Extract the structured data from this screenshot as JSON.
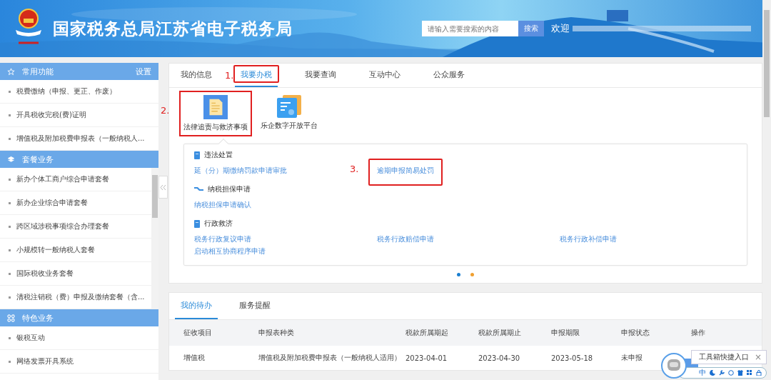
{
  "header": {
    "title": "国家税务总局江苏省电子税务局",
    "search_placeholder": "请输入需要搜索的内容",
    "search_button": "搜索",
    "welcome": "欢迎"
  },
  "sidebar": {
    "sections": [
      {
        "title": "常用功能",
        "action": "设置",
        "scrollable": false,
        "items": [
          "税费缴纳（申报、更正、作废）",
          "开具税收完税(费)证明",
          "增值税及附加税费申报表（一般纳税人..."
        ]
      },
      {
        "title": "套餐业务",
        "scrollable": true,
        "items": [
          "新办个体工商户综合申请套餐",
          "新办企业综合申请套餐",
          "跨区域涉税事项综合办理套餐",
          "小规模转一般纳税人套餐",
          "国际税收业务套餐",
          "清税注销税（费）申报及缴纳套餐（含..."
        ]
      },
      {
        "title": "特色业务",
        "scrollable": false,
        "items": [
          "银税互动",
          "网络发票开具系统"
        ]
      }
    ]
  },
  "tabs": [
    {
      "label": "我的信息",
      "selected": false
    },
    {
      "label": "我要办税",
      "selected": true,
      "annotation": "1."
    },
    {
      "label": "我要查询",
      "selected": false
    },
    {
      "label": "互动中心",
      "selected": false
    },
    {
      "label": "公众服务",
      "selected": false
    }
  ],
  "services": [
    {
      "label": "法律追责与救济事项",
      "selected": true,
      "annotation": "2."
    },
    {
      "label": "乐企数字开放平台",
      "selected": false
    }
  ],
  "groups": [
    {
      "title": "违法处置",
      "links": [
        {
          "label": "延（分）期缴纳罚款申请审批"
        },
        {
          "label": "逾期申报简易处罚",
          "annotation": "3."
        }
      ]
    },
    {
      "title": "纳税担保申请",
      "links": [
        {
          "label": "纳税担保申请确认"
        }
      ]
    },
    {
      "title": "行政救济",
      "links": [
        {
          "label": "税务行政复议申请"
        },
        {
          "label": "税务行政赔偿申请"
        },
        {
          "label": "税务行政补偿申请"
        },
        {
          "label": "启动相互协商程序申请"
        }
      ]
    }
  ],
  "carousel_dots": [
    {
      "selected": true
    },
    {
      "selected": false
    }
  ],
  "todo": {
    "tabs": [
      {
        "label": "我的待办",
        "selected": true
      },
      {
        "label": "服务提醒",
        "selected": false
      }
    ],
    "columns": [
      "征收项目",
      "申报表种类",
      "税款所属期起",
      "税款所属期止",
      "申报期限",
      "申报状态",
      "操作"
    ],
    "rows": [
      [
        "增值税",
        "增值税及附加税费申报表（一般纳税人适用）",
        "2023-04-01",
        "2023-04-30",
        "2023-05-18",
        "未申报"
      ]
    ]
  },
  "toolbox": {
    "tooltip": "工具箱快捷入口",
    "close": "×",
    "input_mode": "中"
  }
}
